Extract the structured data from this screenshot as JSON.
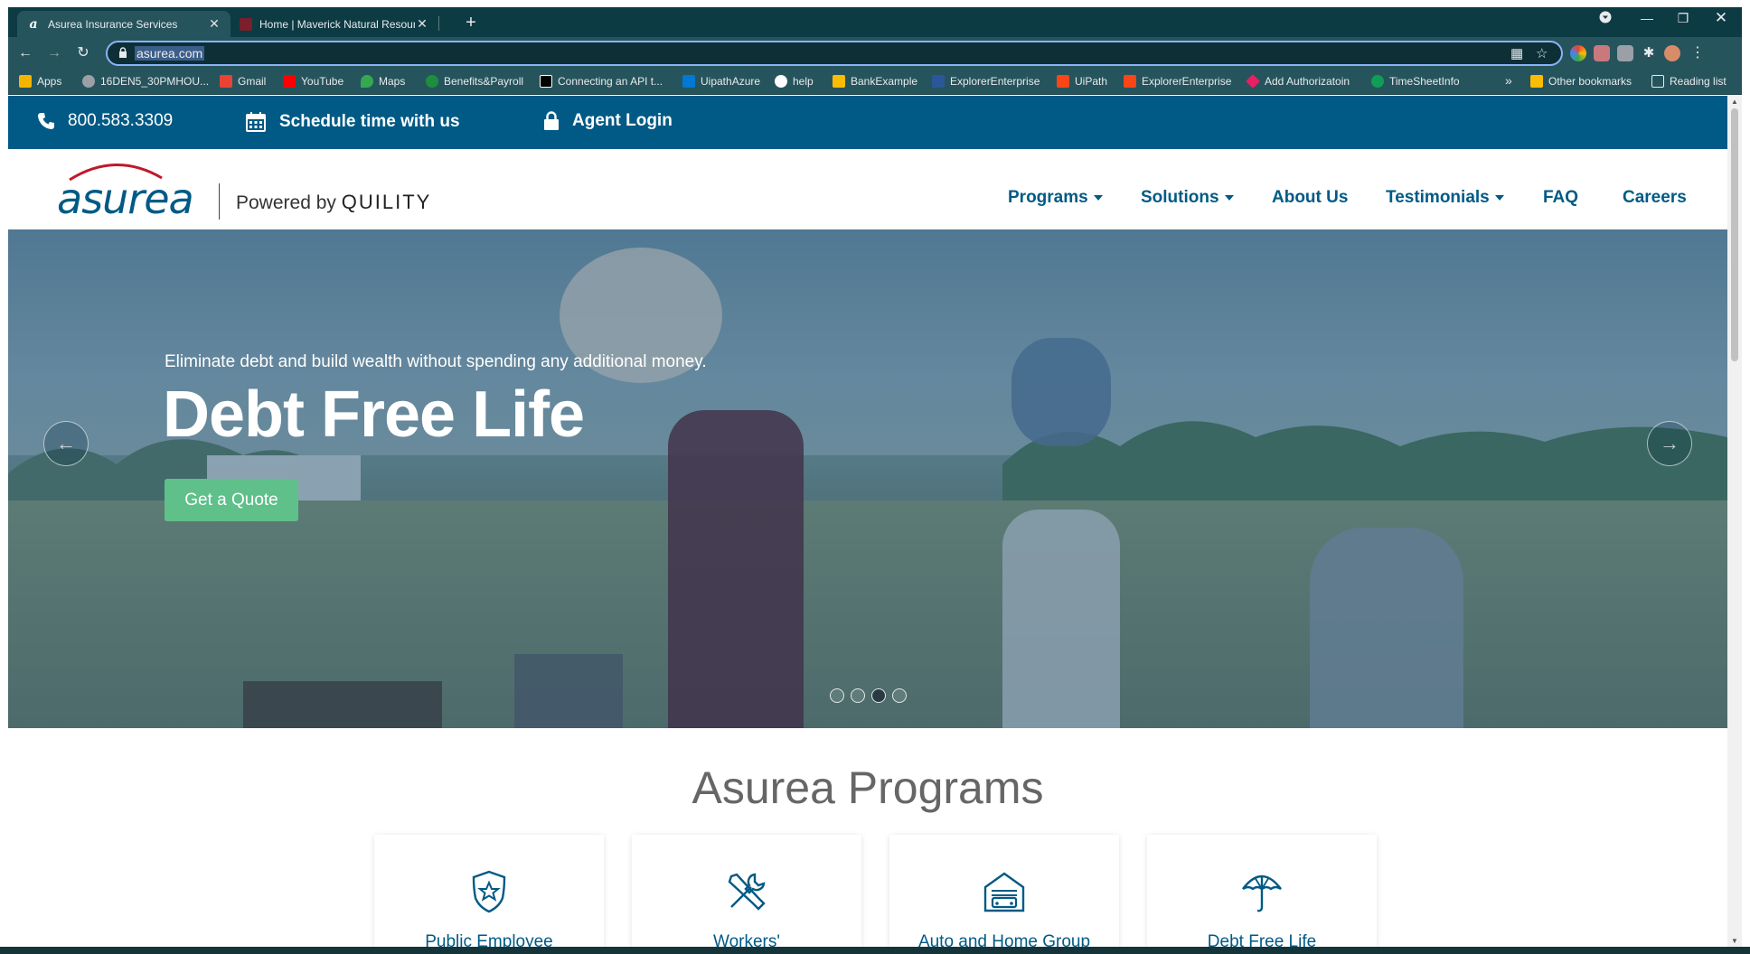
{
  "browser": {
    "tabs": [
      {
        "title": "Asurea Insurance Services",
        "active": true
      },
      {
        "title": "Home | Maverick Natural Resourc",
        "active": false
      }
    ],
    "url": "asurea.com",
    "bookmarks": [
      {
        "label": "Apps",
        "icon": "apps-grid-icon",
        "color": "#f4b400"
      },
      {
        "label": "16DEN5_30PMHOU...",
        "icon": "globe-icon",
        "color": "#9aa0a6"
      },
      {
        "label": "Gmail",
        "icon": "gmail-icon",
        "color": "#ea4335"
      },
      {
        "label": "YouTube",
        "icon": "youtube-icon",
        "color": "#ff0000"
      },
      {
        "label": "Maps",
        "icon": "maps-icon",
        "color": "#34a853"
      },
      {
        "label": "Benefits&Payroll",
        "icon": "payroll-icon",
        "color": "#1e8e3e"
      },
      {
        "label": "Connecting an API t...",
        "icon": "medium-icon",
        "color": "#000000"
      },
      {
        "label": "UipathAzure",
        "icon": "azure-icon",
        "color": "#0078d4"
      },
      {
        "label": "help",
        "icon": "github-icon",
        "color": "#ffffff"
      },
      {
        "label": "BankExample",
        "icon": "bank-icon",
        "color": "#fbbc04"
      },
      {
        "label": "ExplorerEnterprise",
        "icon": "word-icon",
        "color": "#2b579a"
      },
      {
        "label": "UiPath",
        "icon": "uipath-icon",
        "color": "#fa4616"
      },
      {
        "label": "ExplorerEnterprise",
        "icon": "uipath-icon",
        "color": "#fa4616"
      },
      {
        "label": "Add Authorizatoin",
        "icon": "diamond-icon",
        "color": "#e91e63"
      },
      {
        "label": "TimeSheetInfo",
        "icon": "cloud-icon",
        "color": "#0f9d58"
      }
    ],
    "overflow": "»",
    "other_bookmarks": "Other bookmarks",
    "reading_list": "Reading list"
  },
  "utility": {
    "phone": "800.583.3309",
    "schedule": "Schedule time with us",
    "agent_login": "Agent Login"
  },
  "brand": {
    "logo": "asurea",
    "powered_by": "Powered by",
    "partner": "QUILITY",
    "brand_color": "#005a85",
    "accent_red": "#c0182b"
  },
  "nav": {
    "programs": "Programs",
    "solutions": "Solutions",
    "about": "About Us",
    "testimonials": "Testimonials",
    "faq": "FAQ",
    "careers": "Careers"
  },
  "hero": {
    "subtitle": "Eliminate debt and build wealth without spending any additional money.",
    "title": "Debt Free Life",
    "cta": "Get a Quote",
    "cta_color": "#5fc08a",
    "slide_count": 4,
    "active_slide": 3
  },
  "programs": {
    "heading": "Asurea Programs",
    "cards": [
      {
        "label": "Public Employee",
        "icon": "police-badge-icon"
      },
      {
        "label": "Workers'",
        "icon": "tools-icon"
      },
      {
        "label": "Auto and Home Group",
        "icon": "garage-car-icon"
      },
      {
        "label": "Debt Free Life",
        "icon": "umbrella-icon"
      }
    ]
  }
}
